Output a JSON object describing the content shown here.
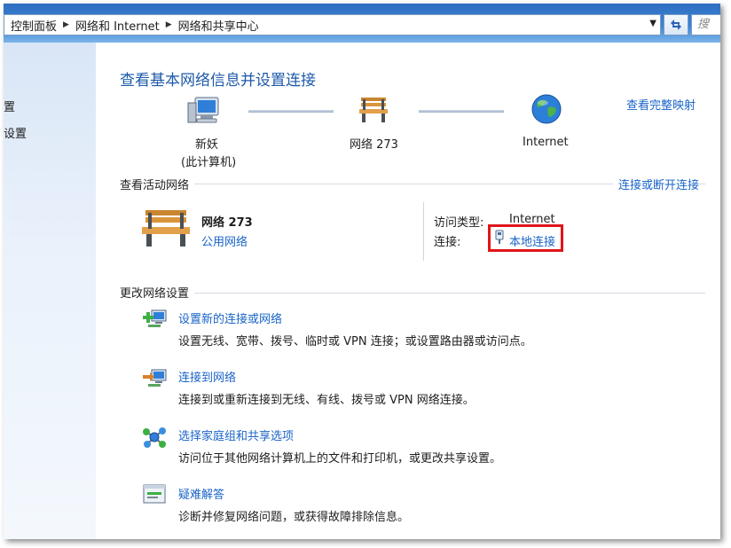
{
  "breadcrumb": {
    "items": [
      "控制面板",
      "网络和 Internet",
      "网络和共享中心"
    ]
  },
  "search": {
    "placeholder": "搜"
  },
  "leftnav": {
    "items": [
      "置",
      "设置"
    ]
  },
  "main": {
    "title": "查看基本网络信息并设置连接",
    "full_map_link": "查看完整映射",
    "map": {
      "computer_name": "新妖",
      "computer_sub": "(此计算机)",
      "network_name": "网络  273",
      "internet_label": "Internet"
    },
    "active": {
      "section_title": "查看活动网络",
      "connect_link": "连接或断开连接",
      "network_name": "网络  273",
      "network_type": "公用网络",
      "access_type_label": "访问类型:",
      "access_type_value": "Internet",
      "connection_label": "连接:",
      "connection_value": "本地连接"
    },
    "change": {
      "section_title": "更改网络设置",
      "items": [
        {
          "title": "设置新的连接或网络",
          "desc": "设置无线、宽带、拨号、临时或 VPN 连接；或设置路由器或访问点。",
          "icon": "new-connection-icon"
        },
        {
          "title": "连接到网络",
          "desc": "连接到或重新连接到无线、有线、拨号或 VPN 网络连接。",
          "icon": "connect-network-icon"
        },
        {
          "title": "选择家庭组和共享选项",
          "desc": "访问位于其他网络计算机上的文件和打印机，或更改共享设置。",
          "icon": "homegroup-icon"
        },
        {
          "title": "疑难解答",
          "desc": "诊断并修复网络问题，或获得故障排除信息。",
          "icon": "troubleshoot-icon"
        }
      ]
    }
  },
  "colors": {
    "link": "#1a64c8",
    "title": "#1e5aa8",
    "highlight": "#e0141a"
  }
}
